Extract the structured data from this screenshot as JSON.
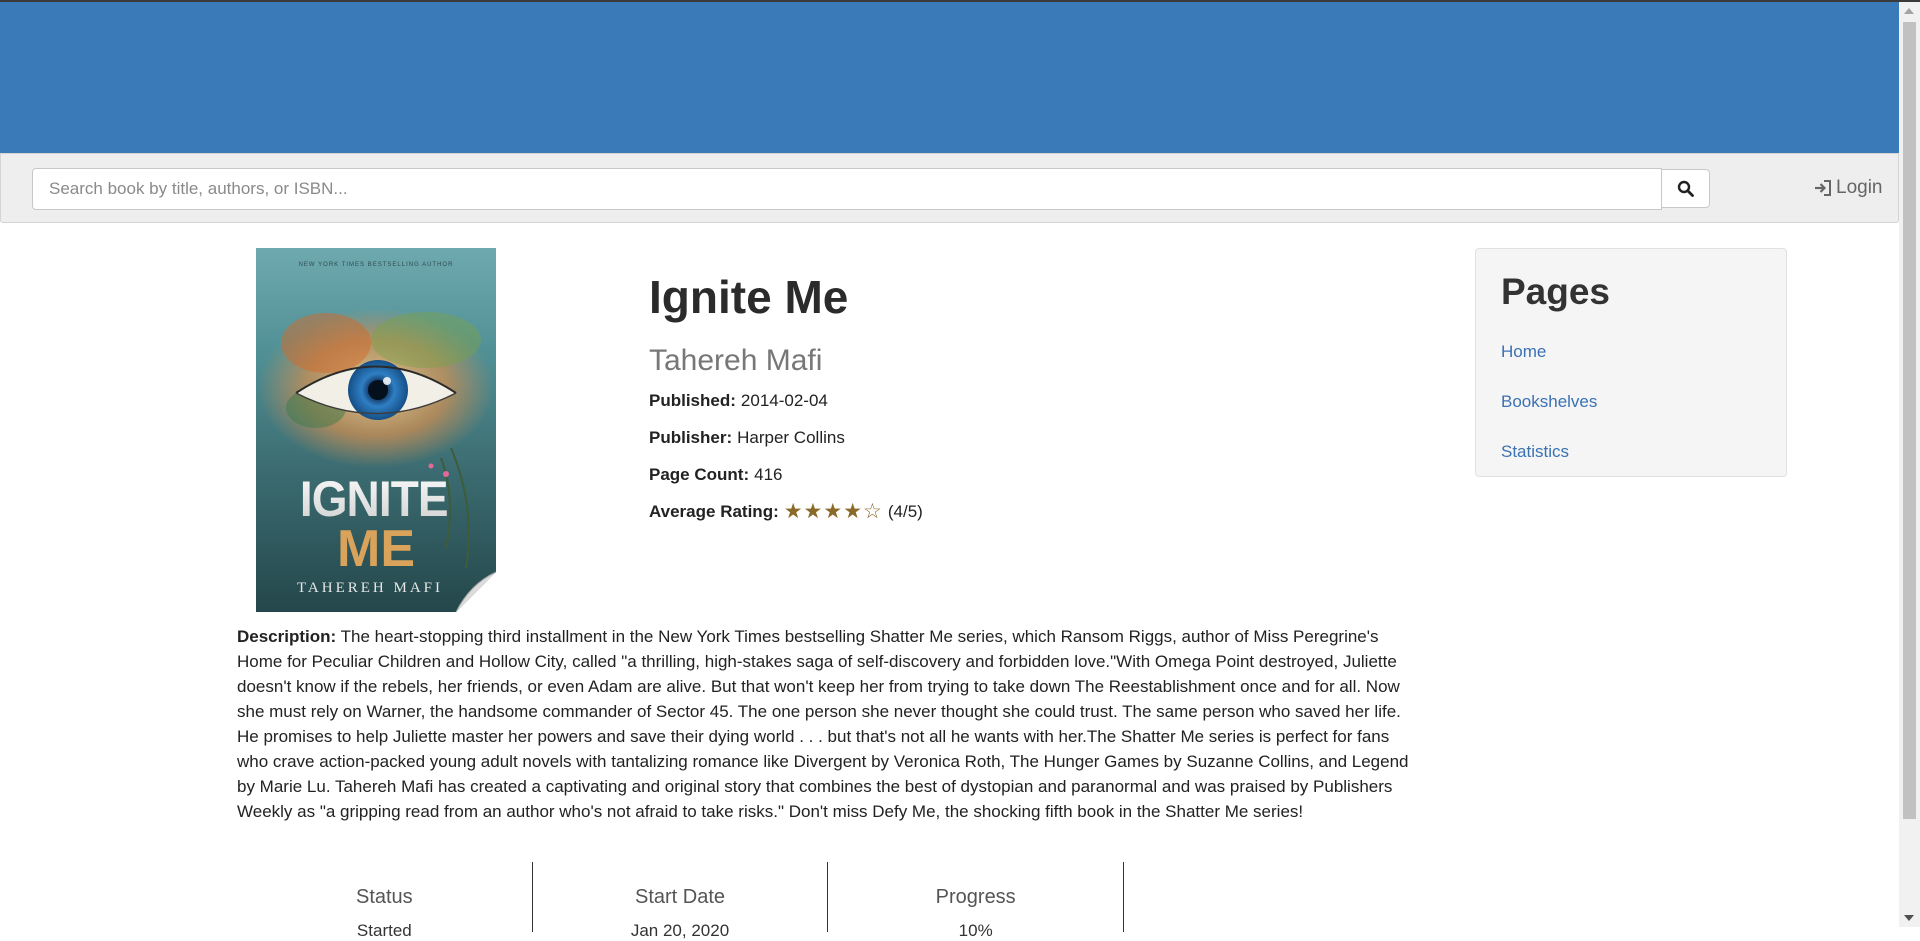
{
  "search": {
    "placeholder": "Search book by title, authors, or ISBN...",
    "button_icon": "search-icon"
  },
  "nav": {
    "login_label": "Login",
    "login_icon": "login-icon"
  },
  "book": {
    "title": "Ignite Me",
    "author": "Tahereh Mafi",
    "published_label": "Published:",
    "published": "2014-02-04",
    "publisher_label": "Publisher:",
    "publisher": "Harper Collins",
    "page_count_label": "Page Count:",
    "page_count": "416",
    "rating_label": "Average Rating:",
    "rating_stars": "★★★★☆",
    "rating_value": 4,
    "rating_max": 5,
    "rating_text": "(4/5)",
    "cover": {
      "title_line1": "IGNITE",
      "title_line2": "ME",
      "author": "TAHEREH MAFI",
      "top_text": "NEW YORK TIMES BESTSELLING AUTHOR"
    },
    "description_label": "Description:",
    "description": "The heart-stopping third installment in the New York Times bestselling Shatter Me series, which Ransom Riggs, author of Miss Peregrine's Home for Peculiar Children and Hollow City, called \"a thrilling, high-stakes saga of self-discovery and forbidden love.\"With Omega Point destroyed, Juliette doesn't know if the rebels, her friends, or even Adam are alive. But that won't keep her from trying to take down The Reestablishment once and for all. Now she must rely on Warner, the handsome commander of Sector 45. The one person she never thought she could trust. The same person who saved her life. He promises to help Juliette master her powers and save their dying world . . . but that's not all he wants with her.The Shatter Me series is perfect for fans who crave action-packed young adult novels with tantalizing romance like Divergent by Veronica Roth, The Hunger Games by Suzanne Collins, and Legend by Marie Lu. Tahereh Mafi has created a captivating and original story that combines the best of dystopian and paranormal and was praised by Publishers Weekly as \"a gripping read from an author who's not afraid to take risks.\" Don't miss Defy Me, the shocking fifth book in the Shatter Me series!"
  },
  "reading_status": {
    "headers": [
      "Status",
      "Start Date",
      "Progress"
    ],
    "values": [
      "Started",
      "Jan 20, 2020",
      "10%"
    ]
  },
  "sidebar": {
    "title": "Pages",
    "links": [
      "Home",
      "Bookshelves",
      "Statistics"
    ]
  },
  "colors": {
    "banner": "#3a7ab8",
    "link": "#3a72b3",
    "star": "#8a6a28"
  }
}
